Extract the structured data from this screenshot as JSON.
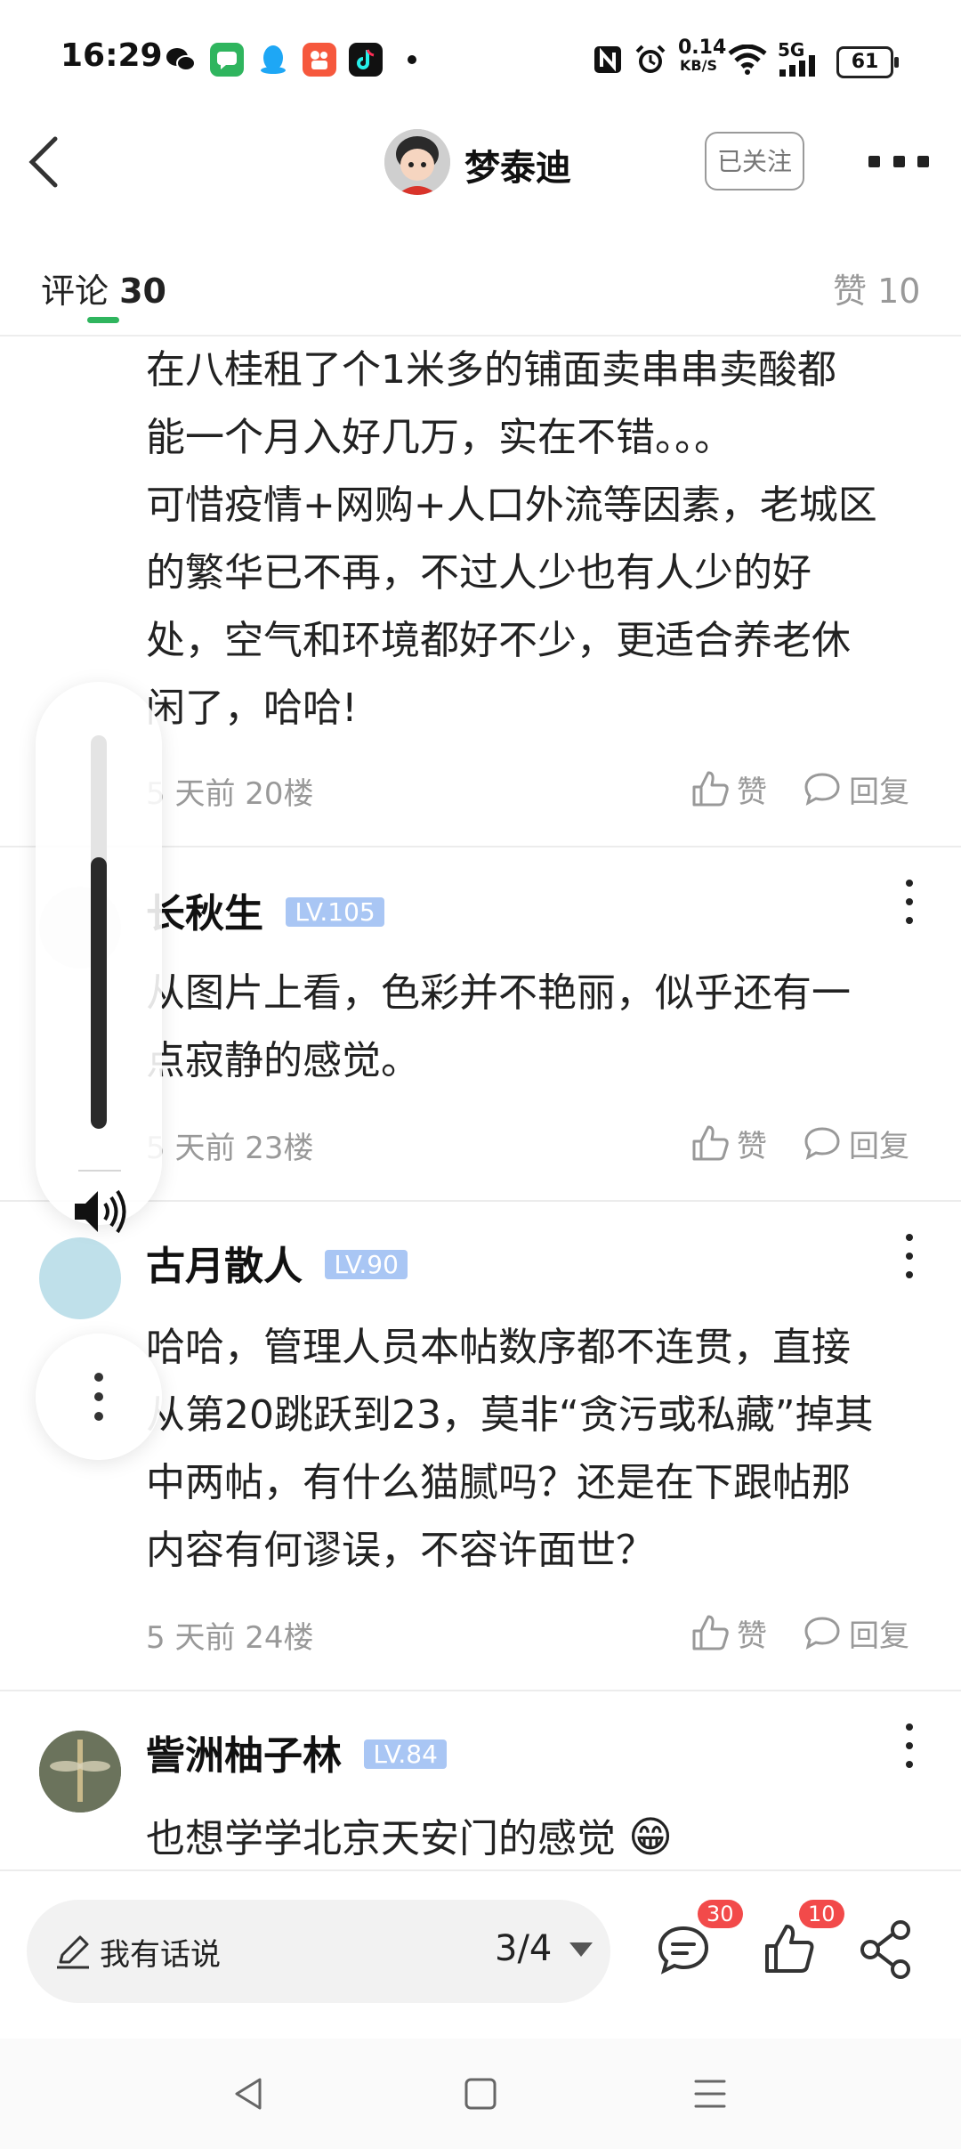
{
  "status_bar": {
    "time": "16:29",
    "net_speed": "0.14",
    "net_unit": "KB/S",
    "network": "5G",
    "battery": "61"
  },
  "header": {
    "author_name": "梦泰迪",
    "follow_label": "已关注"
  },
  "tabs": {
    "comments_label": "评论",
    "comments_count": "30",
    "likes_label": "赞 10"
  },
  "comments": [
    {
      "text_lines": [
        "在八桂租了个1米多的铺面卖串串卖酸都",
        "能一个月入好几万，实在不错。。。",
        "可惜疫情+网购+人口外流等因素，老城区",
        "的繁华已不再，不过人少也有人少的好",
        "处，空气和环境都好不少，更适合养老休",
        "闲了，哈哈!"
      ],
      "meta": "5 天前  20楼",
      "like_label": "赞",
      "reply_label": "回复"
    },
    {
      "user": "长秋生",
      "level": "LV.105",
      "text_lines": [
        "从图片上看，色彩并不艳丽，似乎还有一",
        "点寂静的感觉。"
      ],
      "meta": "5 天前  23楼",
      "like_label": "赞",
      "reply_label": "回复"
    },
    {
      "user": "古月散人",
      "level": "LV.90",
      "text_lines": [
        "哈哈，管理人员本帖数序都不连贯，直接",
        "从第20跳跃到23，莫非“贪污或私藏”掉其",
        "中两帖，有什么猫腻吗？还是在下跟帖那",
        "内容有何谬误，不容许面世？"
      ],
      "meta": "5 天前  24楼",
      "like_label": "赞",
      "reply_label": "回复"
    },
    {
      "user": "訾洲柚子林",
      "level": "LV.84",
      "text_lines": [
        "也想学学北京天安门的感觉"
      ],
      "emoji": "😁"
    }
  ],
  "volume": {
    "level": 0.69
  },
  "bottom_bar": {
    "input_placeholder": "我有话说",
    "page_indicator": "3/4",
    "comment_badge": "30",
    "like_badge": "10"
  },
  "colors": {
    "accent": "#2fb55e",
    "badge": "#f24a4a",
    "level_badge": "#a9c6f4"
  }
}
